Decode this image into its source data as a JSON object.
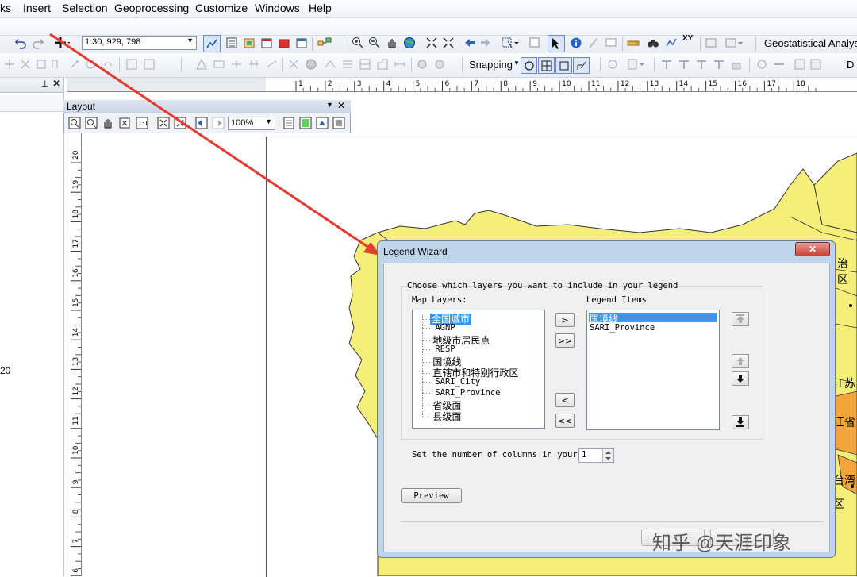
{
  "menu": {
    "items": [
      "ks",
      "Insert",
      "Selection",
      "Geoprocessing",
      "Customize",
      "Windows",
      "Help"
    ]
  },
  "toolbar1": {
    "scale_value": "1:30, 929, 798",
    "extension_label": "Geostatistical Analys"
  },
  "toolbar2": {
    "snapping_label": "Snapping",
    "cut_label": "D"
  },
  "left_panel": {
    "partial_label": "20"
  },
  "layout_toolbar": {
    "title": "Layout",
    "zoom_value": "100%"
  },
  "ruler": {
    "h_ticks": [
      "1",
      "2",
      "3",
      "4",
      "5",
      "6",
      "7",
      "8",
      "9",
      "10",
      "11",
      "12",
      "13",
      "14",
      "15",
      "16",
      "17",
      "18"
    ],
    "v_ticks": [
      "20",
      "19",
      "18",
      "17",
      "16",
      "15",
      "14",
      "13",
      "12",
      "11",
      "10",
      "9",
      "8",
      "7",
      "6"
    ]
  },
  "map_labels": {
    "l1": "治区",
    "l2": "江苏",
    "l3": "江省",
    "l4": "台湾",
    "l5": "区"
  },
  "dialog": {
    "title": "Legend Wizard",
    "close_label": "✕",
    "instruction": "Choose which layers you want to include in your legend",
    "map_layers_label": "Map Layers:",
    "legend_items_label": "Legend Items",
    "map_layers": [
      "全国城市",
      "AGNP",
      "地级市居民点",
      "RESP",
      "国境线",
      "直辖市和特别行政区",
      "SARI_City",
      "SARI_Province",
      "省级面",
      "县级面"
    ],
    "legend_items": [
      "国境线",
      "SARI_Province"
    ],
    "add_label": ">",
    "add_all_label": ">>",
    "remove_label": "<",
    "remove_all_label": "<<",
    "columns_label": "Set the number of columns in your",
    "columns_value": "1",
    "preview_label": "Preview"
  },
  "watermark": {
    "text": "知乎 @天涯印象"
  },
  "colors": {
    "map_yellow": "#f5ef7a",
    "map_orange": "#f2a53a",
    "accent_selection": "#3399ff",
    "arrow_red": "#e53a2f",
    "dialog_frame": "#bfd5ea",
    "close_red": "#c9403a"
  }
}
